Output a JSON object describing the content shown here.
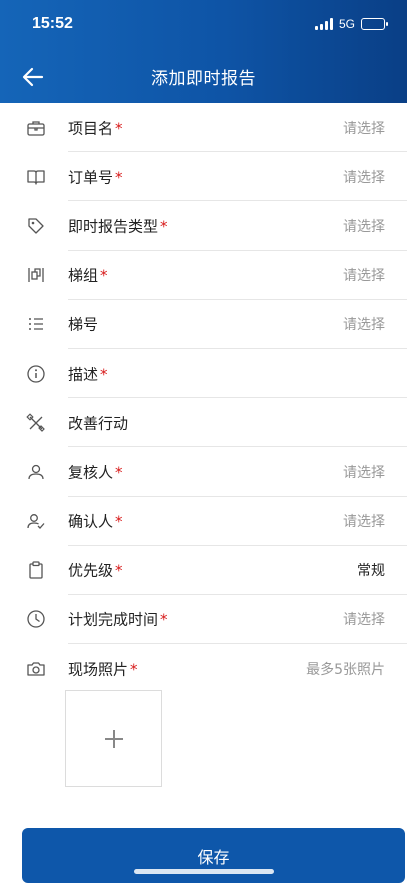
{
  "status": {
    "time": "15:52",
    "network": "5G"
  },
  "nav": {
    "title": "添加即时报告"
  },
  "form": {
    "rows": [
      {
        "label": "项目名",
        "required": "*",
        "value": "请选择",
        "icon": "briefcase-icon"
      },
      {
        "label": "订单号",
        "required": "*",
        "value": "请选择",
        "icon": "book-icon"
      },
      {
        "label": "即时报告类型",
        "required": "*",
        "value": "请选择",
        "icon": "tag-icon"
      },
      {
        "label": "梯组",
        "required": "*",
        "value": "请选择",
        "icon": "group-icon"
      },
      {
        "label": "梯号",
        "required": "",
        "value": "请选择",
        "icon": "list-icon"
      },
      {
        "label": "描述",
        "required": "*",
        "value": "",
        "icon": "info-icon"
      },
      {
        "label": "改善行动",
        "required": "",
        "value": "",
        "icon": "tools-icon"
      },
      {
        "label": "复核人",
        "required": "*",
        "value": "请选择",
        "icon": "user-icon"
      },
      {
        "label": "确认人",
        "required": "*",
        "value": "请选择",
        "icon": "user-check-icon"
      },
      {
        "label": "优先级",
        "required": "*",
        "value": "常规",
        "icon": "clipboard-icon"
      },
      {
        "label": "计划完成时间",
        "required": "*",
        "value": "请选择",
        "icon": "clock-icon"
      },
      {
        "label": "现场照片",
        "required": "*",
        "value": "最多5张照片",
        "icon": "camera-icon"
      }
    ]
  },
  "photo": {
    "add_symbol": "+"
  },
  "footer": {
    "save_label": "保存"
  }
}
